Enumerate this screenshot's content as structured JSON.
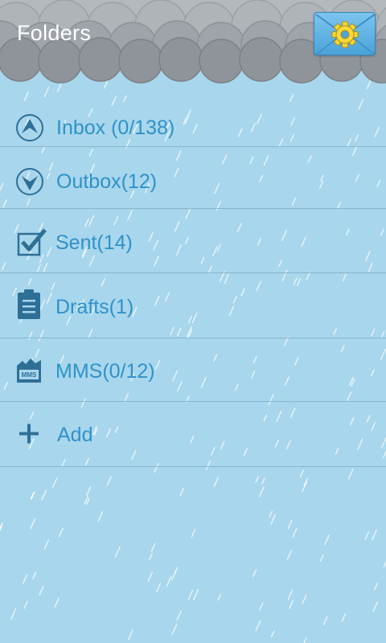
{
  "header": {
    "title": "Folders",
    "settings_icon": "gear-icon",
    "accent": "#f5d83a"
  },
  "folders": [
    {
      "label": "Inbox (0/138)",
      "icon": "up-arrow-circle-icon"
    },
    {
      "label": "Outbox(12)",
      "icon": "down-arrow-circle-icon"
    },
    {
      "label": "Sent(14)",
      "icon": "checkbox-checked-icon"
    },
    {
      "label": "Drafts(1)",
      "icon": "clipboard-icon"
    },
    {
      "label": "MMS(0/12)",
      "icon": "mms-icon",
      "icon_text": "MMS"
    },
    {
      "label": "Add",
      "icon": "plus-icon"
    }
  ],
  "colors": {
    "background": "#a8d6ec",
    "text": "#2f92c8",
    "icon": "#2e6f96",
    "cloud": "#a7adb2"
  }
}
